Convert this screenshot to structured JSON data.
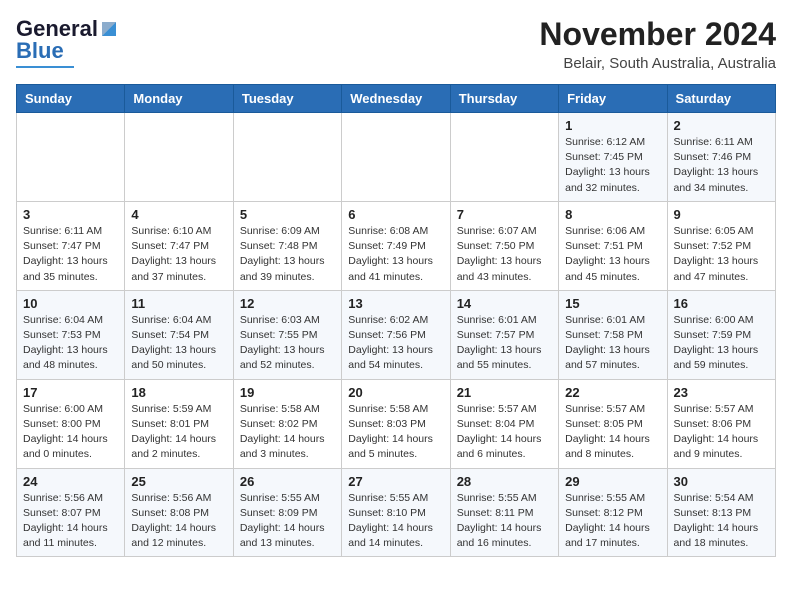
{
  "header": {
    "logo_line1": "General",
    "logo_line2": "Blue",
    "title": "November 2024",
    "subtitle": "Belair, South Australia, Australia"
  },
  "weekdays": [
    "Sunday",
    "Monday",
    "Tuesday",
    "Wednesday",
    "Thursday",
    "Friday",
    "Saturday"
  ],
  "weeks": [
    [
      {
        "day": "",
        "info": ""
      },
      {
        "day": "",
        "info": ""
      },
      {
        "day": "",
        "info": ""
      },
      {
        "day": "",
        "info": ""
      },
      {
        "day": "",
        "info": ""
      },
      {
        "day": "1",
        "info": "Sunrise: 6:12 AM\nSunset: 7:45 PM\nDaylight: 13 hours and 32 minutes."
      },
      {
        "day": "2",
        "info": "Sunrise: 6:11 AM\nSunset: 7:46 PM\nDaylight: 13 hours and 34 minutes."
      }
    ],
    [
      {
        "day": "3",
        "info": "Sunrise: 6:11 AM\nSunset: 7:47 PM\nDaylight: 13 hours and 35 minutes."
      },
      {
        "day": "4",
        "info": "Sunrise: 6:10 AM\nSunset: 7:47 PM\nDaylight: 13 hours and 37 minutes."
      },
      {
        "day": "5",
        "info": "Sunrise: 6:09 AM\nSunset: 7:48 PM\nDaylight: 13 hours and 39 minutes."
      },
      {
        "day": "6",
        "info": "Sunrise: 6:08 AM\nSunset: 7:49 PM\nDaylight: 13 hours and 41 minutes."
      },
      {
        "day": "7",
        "info": "Sunrise: 6:07 AM\nSunset: 7:50 PM\nDaylight: 13 hours and 43 minutes."
      },
      {
        "day": "8",
        "info": "Sunrise: 6:06 AM\nSunset: 7:51 PM\nDaylight: 13 hours and 45 minutes."
      },
      {
        "day": "9",
        "info": "Sunrise: 6:05 AM\nSunset: 7:52 PM\nDaylight: 13 hours and 47 minutes."
      }
    ],
    [
      {
        "day": "10",
        "info": "Sunrise: 6:04 AM\nSunset: 7:53 PM\nDaylight: 13 hours and 48 minutes."
      },
      {
        "day": "11",
        "info": "Sunrise: 6:04 AM\nSunset: 7:54 PM\nDaylight: 13 hours and 50 minutes."
      },
      {
        "day": "12",
        "info": "Sunrise: 6:03 AM\nSunset: 7:55 PM\nDaylight: 13 hours and 52 minutes."
      },
      {
        "day": "13",
        "info": "Sunrise: 6:02 AM\nSunset: 7:56 PM\nDaylight: 13 hours and 54 minutes."
      },
      {
        "day": "14",
        "info": "Sunrise: 6:01 AM\nSunset: 7:57 PM\nDaylight: 13 hours and 55 minutes."
      },
      {
        "day": "15",
        "info": "Sunrise: 6:01 AM\nSunset: 7:58 PM\nDaylight: 13 hours and 57 minutes."
      },
      {
        "day": "16",
        "info": "Sunrise: 6:00 AM\nSunset: 7:59 PM\nDaylight: 13 hours and 59 minutes."
      }
    ],
    [
      {
        "day": "17",
        "info": "Sunrise: 6:00 AM\nSunset: 8:00 PM\nDaylight: 14 hours and 0 minutes."
      },
      {
        "day": "18",
        "info": "Sunrise: 5:59 AM\nSunset: 8:01 PM\nDaylight: 14 hours and 2 minutes."
      },
      {
        "day": "19",
        "info": "Sunrise: 5:58 AM\nSunset: 8:02 PM\nDaylight: 14 hours and 3 minutes."
      },
      {
        "day": "20",
        "info": "Sunrise: 5:58 AM\nSunset: 8:03 PM\nDaylight: 14 hours and 5 minutes."
      },
      {
        "day": "21",
        "info": "Sunrise: 5:57 AM\nSunset: 8:04 PM\nDaylight: 14 hours and 6 minutes."
      },
      {
        "day": "22",
        "info": "Sunrise: 5:57 AM\nSunset: 8:05 PM\nDaylight: 14 hours and 8 minutes."
      },
      {
        "day": "23",
        "info": "Sunrise: 5:57 AM\nSunset: 8:06 PM\nDaylight: 14 hours and 9 minutes."
      }
    ],
    [
      {
        "day": "24",
        "info": "Sunrise: 5:56 AM\nSunset: 8:07 PM\nDaylight: 14 hours and 11 minutes."
      },
      {
        "day": "25",
        "info": "Sunrise: 5:56 AM\nSunset: 8:08 PM\nDaylight: 14 hours and 12 minutes."
      },
      {
        "day": "26",
        "info": "Sunrise: 5:55 AM\nSunset: 8:09 PM\nDaylight: 14 hours and 13 minutes."
      },
      {
        "day": "27",
        "info": "Sunrise: 5:55 AM\nSunset: 8:10 PM\nDaylight: 14 hours and 14 minutes."
      },
      {
        "day": "28",
        "info": "Sunrise: 5:55 AM\nSunset: 8:11 PM\nDaylight: 14 hours and 16 minutes."
      },
      {
        "day": "29",
        "info": "Sunrise: 5:55 AM\nSunset: 8:12 PM\nDaylight: 14 hours and 17 minutes."
      },
      {
        "day": "30",
        "info": "Sunrise: 5:54 AM\nSunset: 8:13 PM\nDaylight: 14 hours and 18 minutes."
      }
    ]
  ]
}
